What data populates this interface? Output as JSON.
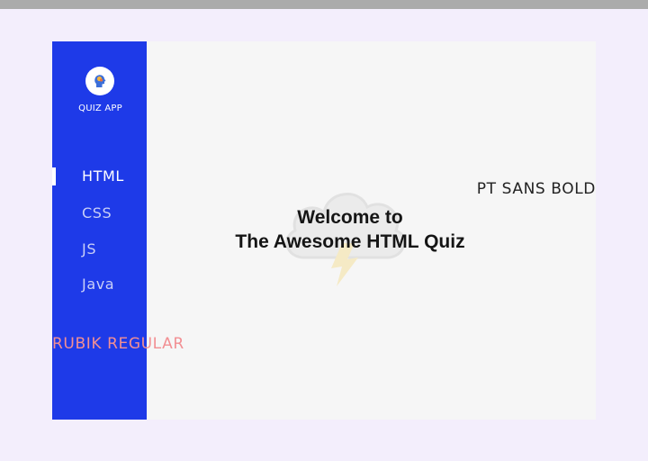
{
  "app": {
    "name": "QUIZ APP",
    "logo_icon": "brain-head-icon"
  },
  "sidebar": {
    "items": [
      {
        "label": "HTML",
        "active": true
      },
      {
        "label": "CSS",
        "active": false
      },
      {
        "label": "JS",
        "active": false
      },
      {
        "label": "Java",
        "active": false
      }
    ]
  },
  "main": {
    "welcome_line1": "Welcome to",
    "welcome_line2": "The Awesome HTML Quiz",
    "background_icon": "thunder-cloud-icon"
  },
  "font_samples": {
    "rubik": "RUBIK REGULAR",
    "pt_sans": "PT SANS BOLD"
  },
  "colors": {
    "page_bg": "#f3eefc",
    "sidebar_bg": "#1e3ae8",
    "card_bg": "#f6f6f6",
    "rubik_sample": "#f28f93"
  }
}
